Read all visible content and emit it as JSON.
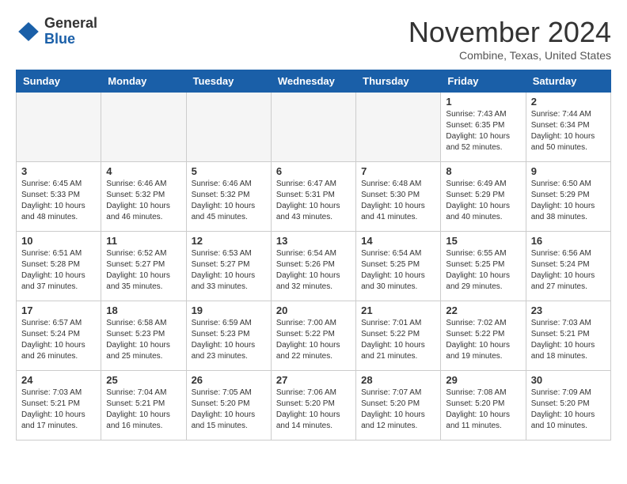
{
  "header": {
    "logo_general": "General",
    "logo_blue": "Blue",
    "month_year": "November 2024",
    "location": "Combine, Texas, United States"
  },
  "days_of_week": [
    "Sunday",
    "Monday",
    "Tuesday",
    "Wednesday",
    "Thursday",
    "Friday",
    "Saturday"
  ],
  "weeks": [
    [
      {
        "day": "",
        "info": ""
      },
      {
        "day": "",
        "info": ""
      },
      {
        "day": "",
        "info": ""
      },
      {
        "day": "",
        "info": ""
      },
      {
        "day": "",
        "info": ""
      },
      {
        "day": "1",
        "info": "Sunrise: 7:43 AM\nSunset: 6:35 PM\nDaylight: 10 hours\nand 52 minutes."
      },
      {
        "day": "2",
        "info": "Sunrise: 7:44 AM\nSunset: 6:34 PM\nDaylight: 10 hours\nand 50 minutes."
      }
    ],
    [
      {
        "day": "3",
        "info": "Sunrise: 6:45 AM\nSunset: 5:33 PM\nDaylight: 10 hours\nand 48 minutes."
      },
      {
        "day": "4",
        "info": "Sunrise: 6:46 AM\nSunset: 5:32 PM\nDaylight: 10 hours\nand 46 minutes."
      },
      {
        "day": "5",
        "info": "Sunrise: 6:46 AM\nSunset: 5:32 PM\nDaylight: 10 hours\nand 45 minutes."
      },
      {
        "day": "6",
        "info": "Sunrise: 6:47 AM\nSunset: 5:31 PM\nDaylight: 10 hours\nand 43 minutes."
      },
      {
        "day": "7",
        "info": "Sunrise: 6:48 AM\nSunset: 5:30 PM\nDaylight: 10 hours\nand 41 minutes."
      },
      {
        "day": "8",
        "info": "Sunrise: 6:49 AM\nSunset: 5:29 PM\nDaylight: 10 hours\nand 40 minutes."
      },
      {
        "day": "9",
        "info": "Sunrise: 6:50 AM\nSunset: 5:29 PM\nDaylight: 10 hours\nand 38 minutes."
      }
    ],
    [
      {
        "day": "10",
        "info": "Sunrise: 6:51 AM\nSunset: 5:28 PM\nDaylight: 10 hours\nand 37 minutes."
      },
      {
        "day": "11",
        "info": "Sunrise: 6:52 AM\nSunset: 5:27 PM\nDaylight: 10 hours\nand 35 minutes."
      },
      {
        "day": "12",
        "info": "Sunrise: 6:53 AM\nSunset: 5:27 PM\nDaylight: 10 hours\nand 33 minutes."
      },
      {
        "day": "13",
        "info": "Sunrise: 6:54 AM\nSunset: 5:26 PM\nDaylight: 10 hours\nand 32 minutes."
      },
      {
        "day": "14",
        "info": "Sunrise: 6:54 AM\nSunset: 5:25 PM\nDaylight: 10 hours\nand 30 minutes."
      },
      {
        "day": "15",
        "info": "Sunrise: 6:55 AM\nSunset: 5:25 PM\nDaylight: 10 hours\nand 29 minutes."
      },
      {
        "day": "16",
        "info": "Sunrise: 6:56 AM\nSunset: 5:24 PM\nDaylight: 10 hours\nand 27 minutes."
      }
    ],
    [
      {
        "day": "17",
        "info": "Sunrise: 6:57 AM\nSunset: 5:24 PM\nDaylight: 10 hours\nand 26 minutes."
      },
      {
        "day": "18",
        "info": "Sunrise: 6:58 AM\nSunset: 5:23 PM\nDaylight: 10 hours\nand 25 minutes."
      },
      {
        "day": "19",
        "info": "Sunrise: 6:59 AM\nSunset: 5:23 PM\nDaylight: 10 hours\nand 23 minutes."
      },
      {
        "day": "20",
        "info": "Sunrise: 7:00 AM\nSunset: 5:22 PM\nDaylight: 10 hours\nand 22 minutes."
      },
      {
        "day": "21",
        "info": "Sunrise: 7:01 AM\nSunset: 5:22 PM\nDaylight: 10 hours\nand 21 minutes."
      },
      {
        "day": "22",
        "info": "Sunrise: 7:02 AM\nSunset: 5:22 PM\nDaylight: 10 hours\nand 19 minutes."
      },
      {
        "day": "23",
        "info": "Sunrise: 7:03 AM\nSunset: 5:21 PM\nDaylight: 10 hours\nand 18 minutes."
      }
    ],
    [
      {
        "day": "24",
        "info": "Sunrise: 7:03 AM\nSunset: 5:21 PM\nDaylight: 10 hours\nand 17 minutes."
      },
      {
        "day": "25",
        "info": "Sunrise: 7:04 AM\nSunset: 5:21 PM\nDaylight: 10 hours\nand 16 minutes."
      },
      {
        "day": "26",
        "info": "Sunrise: 7:05 AM\nSunset: 5:20 PM\nDaylight: 10 hours\nand 15 minutes."
      },
      {
        "day": "27",
        "info": "Sunrise: 7:06 AM\nSunset: 5:20 PM\nDaylight: 10 hours\nand 14 minutes."
      },
      {
        "day": "28",
        "info": "Sunrise: 7:07 AM\nSunset: 5:20 PM\nDaylight: 10 hours\nand 12 minutes."
      },
      {
        "day": "29",
        "info": "Sunrise: 7:08 AM\nSunset: 5:20 PM\nDaylight: 10 hours\nand 11 minutes."
      },
      {
        "day": "30",
        "info": "Sunrise: 7:09 AM\nSunset: 5:20 PM\nDaylight: 10 hours\nand 10 minutes."
      }
    ]
  ]
}
